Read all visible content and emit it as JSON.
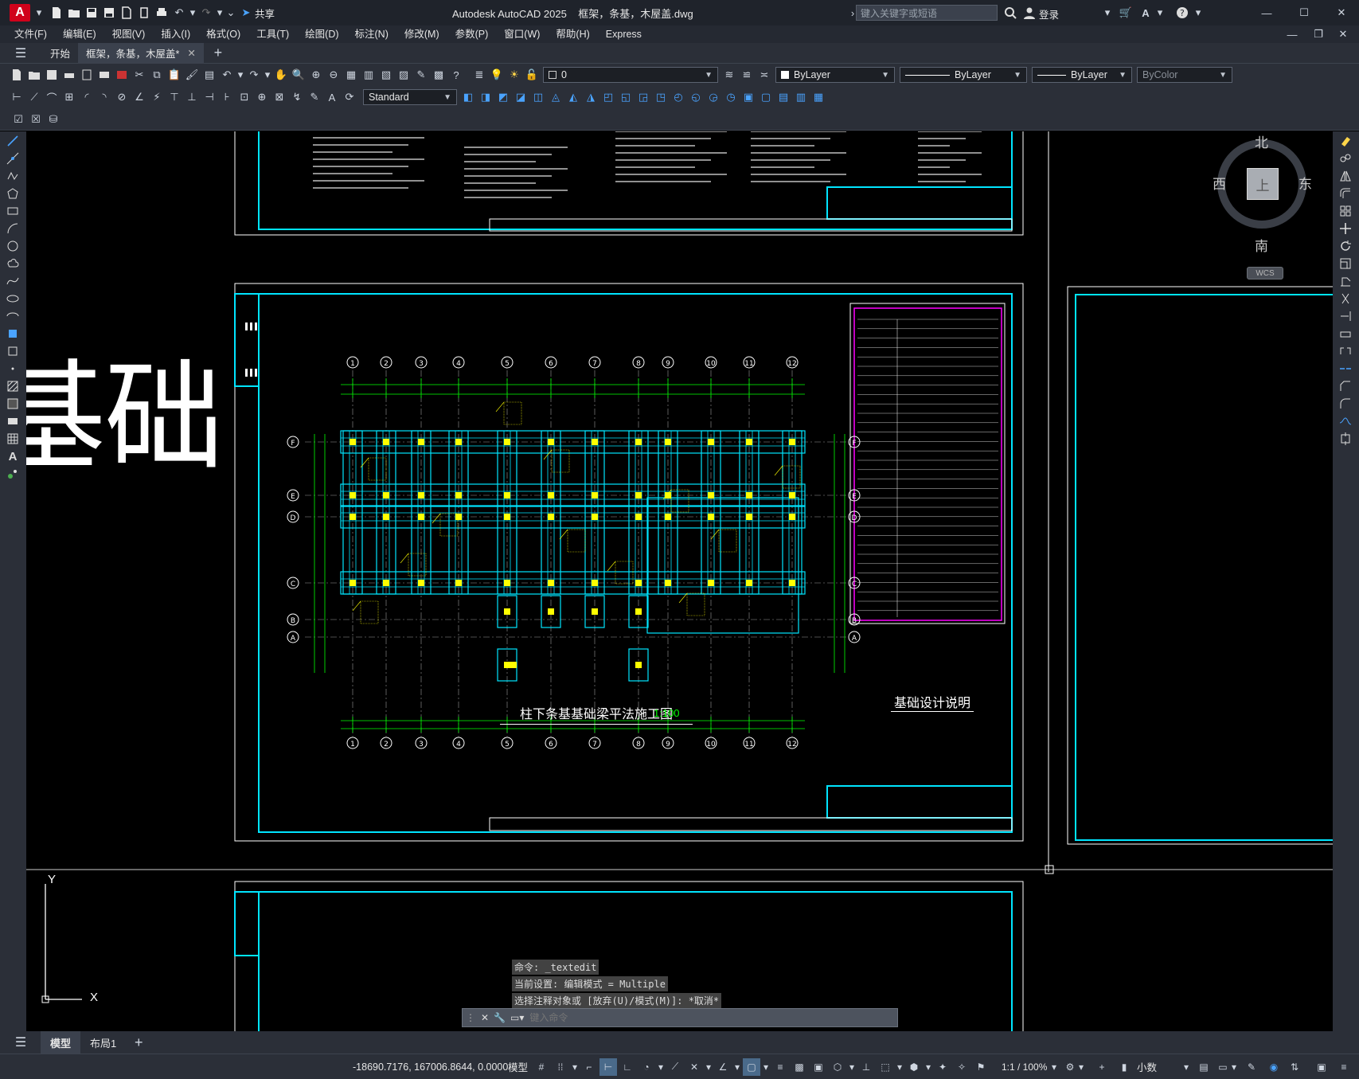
{
  "window": {
    "title": "Autodesk AutoCAD 2025    框架，条基，木屋盖.dwg",
    "share_label": "共享",
    "search_placeholder": "键入关键字或短语",
    "login_label": "登录"
  },
  "menu": [
    "文件(F)",
    "编辑(E)",
    "视图(V)",
    "插入(I)",
    "格式(O)",
    "工具(T)",
    "绘图(D)",
    "标注(N)",
    "修改(M)",
    "参数(P)",
    "窗口(W)",
    "帮助(H)",
    "Express"
  ],
  "doc_tabs": {
    "start": "开始",
    "active": "框架，条基，木屋盖*"
  },
  "toolbar": {
    "layer_name": "0",
    "color": "ByLayer",
    "linetype": "ByLayer",
    "lineweight": "ByLayer",
    "plotstyle": "ByColor",
    "textstyle": "Standard"
  },
  "viewcube": {
    "north": "北",
    "south": "南",
    "east": "东",
    "west": "西",
    "top": "上",
    "wcs": "WCS"
  },
  "drawing": {
    "big_text": "基础",
    "plan_title": "柱下条基基础梁平法施工图",
    "plan_scale": "1:100",
    "design_notes_title": "基础设计说明",
    "grid_top": [
      "1",
      "2",
      "3",
      "4",
      "5",
      "6",
      "7",
      "8",
      "9",
      "10",
      "11",
      "12"
    ],
    "grid_side": [
      "F",
      "E",
      "D",
      "C",
      "B",
      "A"
    ],
    "ucs_x": "X",
    "ucs_y": "Y"
  },
  "command": {
    "history": [
      "命令: _textedit",
      "当前设置: 编辑模式 = Multiple",
      "选择注释对象或 [放弃(U)/模式(M)]: *取消*"
    ],
    "placeholder": "键入命令"
  },
  "layout_tabs": [
    "模型",
    "布局1"
  ],
  "status": {
    "coords": "-18690.7176, 167006.8644, 0.0000",
    "space": "模型",
    "scale": "1:1 / 100%",
    "units": "小数"
  },
  "colors": {
    "cyan": "#00e5ff",
    "yellow": "#ffff00",
    "green": "#00ff00",
    "magenta": "#ff00ff",
    "white": "#ffffff",
    "chrome": "#2b2f38"
  }
}
